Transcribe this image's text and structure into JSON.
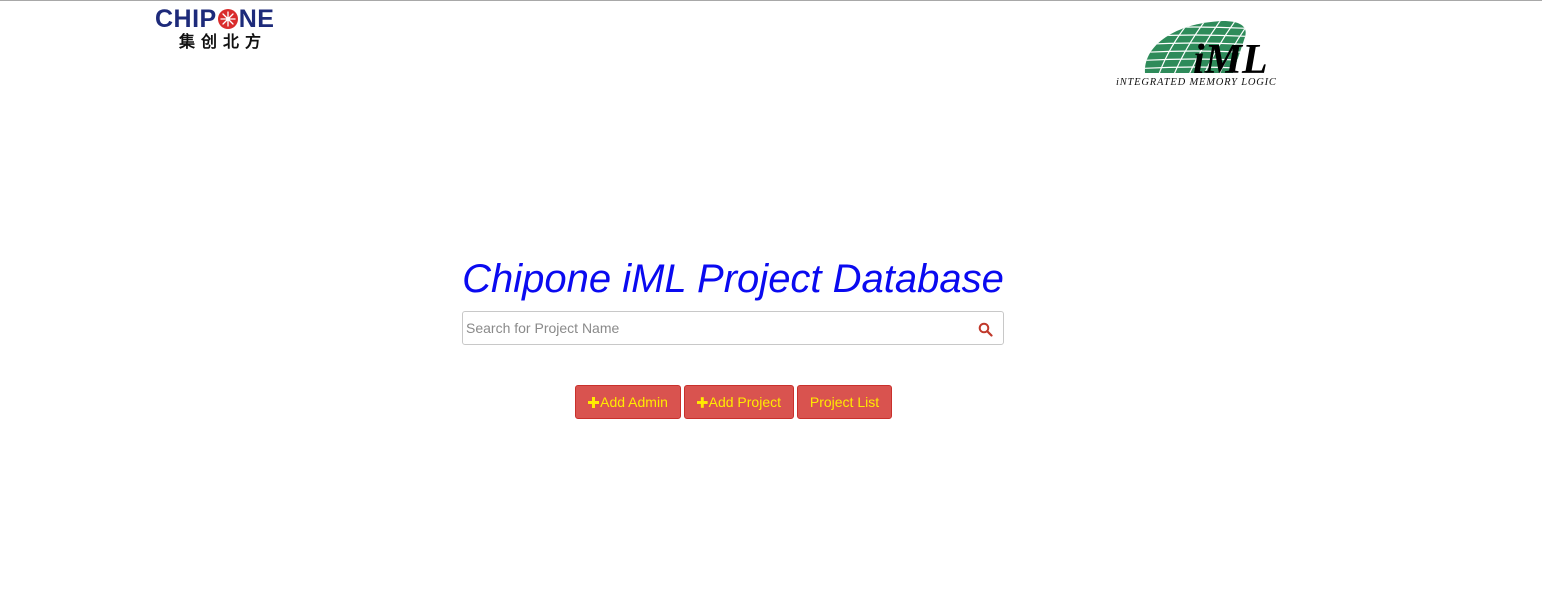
{
  "header": {
    "chipone_logo": {
      "word_prefix": "CHIP",
      "word_suffix": "NE",
      "chinese": "集创北方",
      "brand_color": "#1d2a7a",
      "accent_color": "#d92b2b"
    },
    "iml_logo": {
      "mark": "iML",
      "tagline": "iNTEGRATED MEMORY LOGIC",
      "color": "#2e8b5a"
    }
  },
  "main": {
    "title": "Chipone iML Project Database",
    "search": {
      "placeholder": "Search for Project Name",
      "value": "",
      "icon": "search-icon"
    },
    "buttons": [
      {
        "label": "Add Admin",
        "icon": "plus-icon"
      },
      {
        "label": "Add Project",
        "icon": "plus-icon"
      },
      {
        "label": "Project List",
        "icon": ""
      }
    ]
  },
  "colors": {
    "title": "#0a0af0",
    "button_bg": "#d9534f",
    "button_text": "#ffeb00",
    "search_icon": "#c0392b"
  }
}
